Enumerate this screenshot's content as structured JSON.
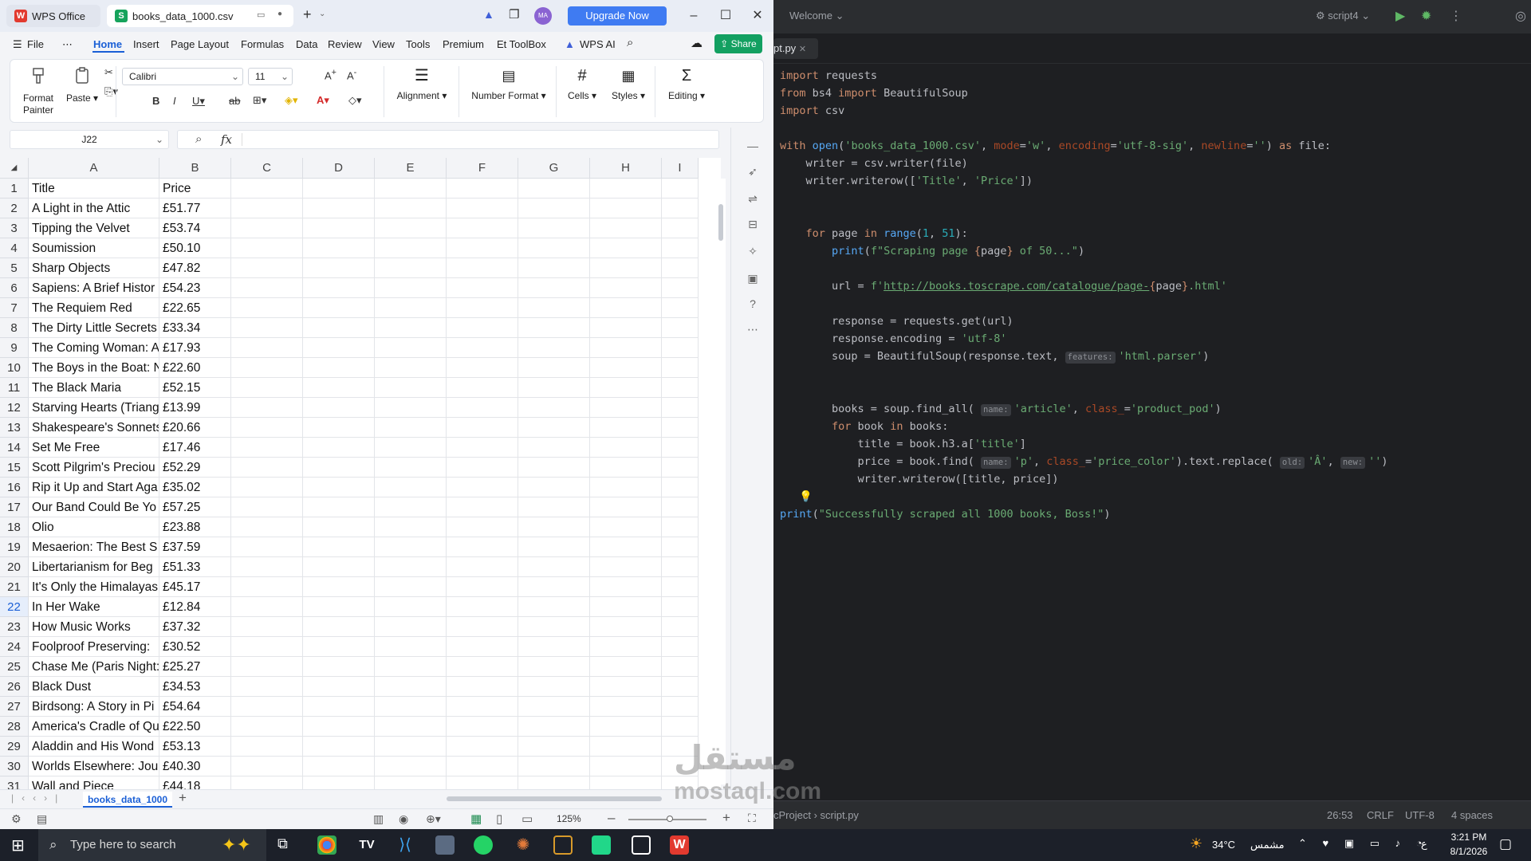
{
  "wps": {
    "tab_home_label": "WPS Office",
    "file_tab_label": "books_data_1000.csv",
    "upgrade_label": "Upgrade Now",
    "avatar_initials": "MA",
    "menu": [
      "File",
      "Home",
      "Insert",
      "Page Layout",
      "Formulas",
      "Data",
      "Review",
      "View",
      "Tools",
      "Premium",
      "Et ToolBox",
      "WPS AI"
    ],
    "share_label": "Share",
    "ribbon": {
      "format_painter": "Format Painter",
      "paste": "Paste",
      "font": "Calibri",
      "size": "11",
      "alignment": "Alignment",
      "number_format": "Number Format",
      "cells": "Cells",
      "styles": "Styles",
      "editing": "Editing"
    },
    "name_box": "J22",
    "fx_label": "fx",
    "columns": [
      "A",
      "B",
      "C",
      "D",
      "E",
      "F",
      "G",
      "H",
      "I"
    ],
    "rows": [
      [
        "1",
        "Title",
        "Price"
      ],
      [
        "2",
        "A Light in the Attic",
        "£51.77"
      ],
      [
        "3",
        "Tipping the Velvet",
        "£53.74"
      ],
      [
        "4",
        "Soumission",
        "£50.10"
      ],
      [
        "5",
        "Sharp Objects",
        "£47.82"
      ],
      [
        "6",
        "Sapiens: A Brief Histor",
        "£54.23"
      ],
      [
        "7",
        "The Requiem Red",
        "£22.65"
      ],
      [
        "8",
        "The Dirty Little Secrets",
        "£33.34"
      ],
      [
        "9",
        "The Coming Woman: A",
        "£17.93"
      ],
      [
        "10",
        "The Boys in the Boat: N",
        "£22.60"
      ],
      [
        "11",
        "The Black Maria",
        "£52.15"
      ],
      [
        "12",
        "Starving Hearts (Triang",
        "£13.99"
      ],
      [
        "13",
        "Shakespeare's Sonnets",
        "£20.66"
      ],
      [
        "14",
        "Set Me Free",
        "£17.46"
      ],
      [
        "15",
        "Scott Pilgrim's Preciou",
        "£52.29"
      ],
      [
        "16",
        "Rip it Up and Start Aga",
        "£35.02"
      ],
      [
        "17",
        "Our Band Could Be Yo",
        "£57.25"
      ],
      [
        "18",
        "Olio",
        "£23.88"
      ],
      [
        "19",
        "Mesaerion: The Best S",
        "£37.59"
      ],
      [
        "20",
        "Libertarianism for Beg",
        "£51.33"
      ],
      [
        "21",
        "It's Only the Himalayas",
        "£45.17"
      ],
      [
        "22",
        "In Her Wake",
        "£12.84"
      ],
      [
        "23",
        "How Music Works",
        "£37.32"
      ],
      [
        "24",
        "Foolproof Preserving:",
        "£30.52"
      ],
      [
        "25",
        "Chase Me (Paris Night:",
        "£25.27"
      ],
      [
        "26",
        "Black Dust",
        "£34.53"
      ],
      [
        "27",
        "Birdsong: A Story in Pi",
        "£54.64"
      ],
      [
        "28",
        "America's Cradle of Qu",
        "£22.50"
      ],
      [
        "29",
        "Aladdin and His Wond",
        "£53.13"
      ],
      [
        "30",
        "Worlds Elsewhere: Jou",
        "£40.30"
      ],
      [
        "31",
        "Wall and Piece",
        "£44.18"
      ]
    ],
    "selected_row": "22",
    "sheet_tab": "books_data_1000",
    "zoom": "125%"
  },
  "ide": {
    "welcome": "Welcome",
    "run_config": "script4",
    "tab": "pt.py",
    "code": [
      "import requests",
      "from bs4 import BeautifulSoup",
      "import csv",
      "",
      "with open('books_data_1000.csv', mode='w', encoding='utf-8-sig', newline='') as file:",
      "    writer = csv.writer(file)",
      "    writer.writerow(['Title', 'Price'])",
      "",
      "",
      "    for page in range(1, 51):",
      "        print(f\"Scraping page {page} of 50...\")",
      "",
      "        url = f'http://books.toscrape.com/catalogue/page-{page}.html'",
      "",
      "        response = requests.get(url)",
      "        response.encoding = 'utf-8'",
      "        soup = BeautifulSoup(response.text, features: 'html.parser')",
      "",
      "",
      "        books = soup.find_all( name: 'article', class_='product_pod')",
      "        for book in books:",
      "            title = book.h3.a['title']",
      "            price = book.find( name: 'p', class_='price_color').text.replace( old: 'Â', new: '')",
      "            writer.writerow([title, price])",
      "",
      "print(\"Successfully scraped all 1000 books, Boss!\")"
    ],
    "status": {
      "breadcrumb_project": "cProject",
      "breadcrumb_file": "script.py",
      "position": "26:53",
      "line_ending": "CRLF",
      "encoding": "UTF-8",
      "indent": "4 spaces"
    }
  },
  "taskbar": {
    "search_placeholder": "Type here to search",
    "weather": "34°C",
    "weather_desc": "مشمس",
    "time": "3:21 PM",
    "date": "8/1/2026",
    "lang": "ع"
  },
  "watermark": {
    "line1": "مستقل",
    "line2": "mostaql.com"
  }
}
